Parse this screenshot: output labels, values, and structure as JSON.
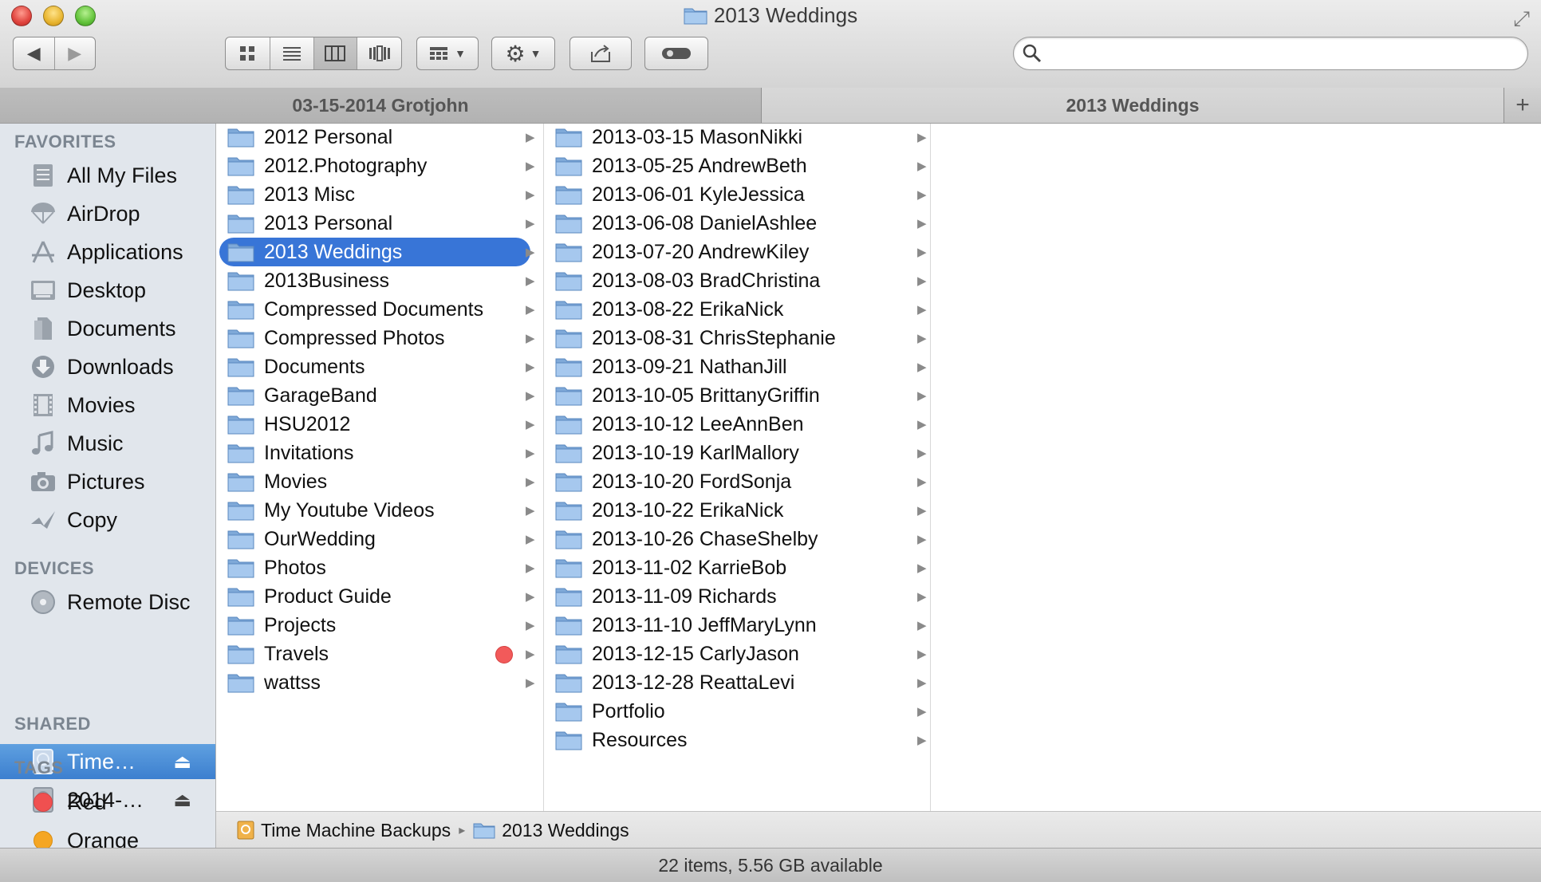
{
  "window": {
    "title": "2013 Weddings"
  },
  "toolbar": {
    "back_icon": "back-arrow-icon",
    "forward_icon": "forward-arrow-icon",
    "view_modes": [
      "icon-view",
      "list-view",
      "column-view",
      "coverflow-view"
    ],
    "active_view": "column-view",
    "search": {
      "value": "",
      "placeholder": ""
    }
  },
  "tabs": [
    {
      "label": "03-15-2014 Grotjohn",
      "active": false
    },
    {
      "label": "2013 Weddings",
      "active": true
    }
  ],
  "tab_add_label": "+",
  "sidebar": {
    "favorites_header": "FAVORITES",
    "favorites": [
      {
        "label": "All My Files",
        "icon": "all-files-icon"
      },
      {
        "label": "AirDrop",
        "icon": "airdrop-icon"
      },
      {
        "label": "Applications",
        "icon": "applications-icon"
      },
      {
        "label": "Desktop",
        "icon": "desktop-icon"
      },
      {
        "label": "Documents",
        "icon": "documents-icon"
      },
      {
        "label": "Downloads",
        "icon": "downloads-icon"
      },
      {
        "label": "Movies",
        "icon": "movies-icon"
      },
      {
        "label": "Music",
        "icon": "music-icon"
      },
      {
        "label": "Pictures",
        "icon": "pictures-icon"
      },
      {
        "label": "Copy",
        "icon": "copy-icon"
      }
    ],
    "devices_header": "DEVICES",
    "devices": [
      {
        "label": "Remote Disc",
        "icon": "remote-disc-icon",
        "eject": false,
        "selected": false
      },
      {
        "label": "Time…",
        "icon": "hard-drive-icon",
        "eject": true,
        "selected": true
      },
      {
        "label": "2014-…",
        "icon": "hard-drive-icon",
        "eject": true,
        "selected": false
      }
    ],
    "eject_glyph": "⏏",
    "shared_header": "SHARED",
    "tags_header": "TAGS",
    "tags": [
      {
        "label": "Red",
        "color": "#f05050"
      },
      {
        "label": "Orange",
        "color": "#f5a623"
      }
    ]
  },
  "column1": {
    "items": [
      "2012 Personal",
      "2012.Photography",
      "2013 Misc",
      "2013 Personal",
      "2013 Weddings",
      "2013Business",
      "Compressed Documents",
      "Compressed Photos",
      "Documents",
      "GarageBand",
      "HSU2012",
      "Invitations",
      "Movies",
      "My Youtube Videos",
      "OurWedding",
      "Photos",
      "Product Guide",
      "Projects",
      "Travels",
      "wattss"
    ],
    "selected": "2013 Weddings",
    "red_tag_item": "Travels"
  },
  "column2": {
    "items": [
      "2013-03-15 MasonNikki",
      "2013-05-25 AndrewBeth",
      "2013-06-01 KyleJessica",
      "2013-06-08 DanielAshlee",
      "2013-07-20 AndrewKiley",
      "2013-08-03 BradChristina",
      "2013-08-22 ErikaNick",
      "2013-08-31 ChrisStephanie",
      "2013-09-21 NathanJill",
      "2013-10-05 BrittanyGriffin",
      "2013-10-12 LeeAnnBen",
      "2013-10-19 KarlMallory",
      "2013-10-20 FordSonja",
      "2013-10-22 ErikaNick",
      "2013-10-26 ChaseShelby",
      "2013-11-02 KarrieBob",
      "2013-11-09 Richards",
      "2013-11-10 JeffMaryLynn",
      "2013-12-15 CarlyJason",
      "2013-12-28 ReattaLevi",
      "Portfolio",
      "Resources"
    ]
  },
  "pathbar": {
    "items": [
      "Time Machine Backups",
      "2013 Weddings"
    ],
    "separator": "▸"
  },
  "status": {
    "text": "22 items, 5.56 GB available"
  },
  "colors": {
    "selection": "#3875d7",
    "sidebar_bg": "#e1e6ec",
    "folder": "#8fb8e4"
  }
}
